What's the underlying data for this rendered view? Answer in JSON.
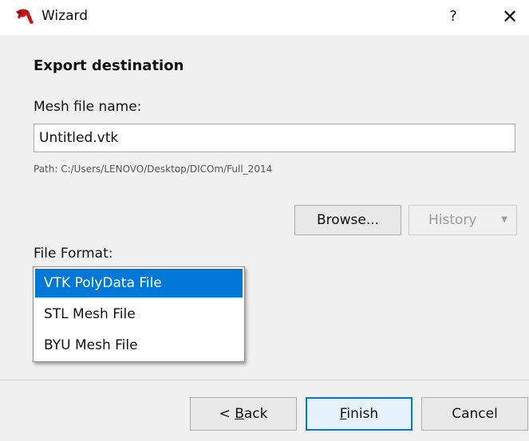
{
  "window": {
    "title": "Wizard",
    "help_glyph": "?",
    "close_glyph": "✕",
    "icon": "app-logo-icon"
  },
  "page": {
    "section_title": "Export destination",
    "mesh_label": "Mesh file name:",
    "mesh_value": "Untitled.vtk",
    "path_text": "Path: C:/Users/LENOVO/Desktop/DICOm/Full_2014",
    "browse_label": "Browse...",
    "history_label": "History",
    "history_arrow": "▼",
    "format_label": "File Format:",
    "formats": [
      {
        "label": "VTK PolyData File",
        "selected": true
      },
      {
        "label": "STL Mesh File",
        "selected": false
      },
      {
        "label": "BYU Mesh File",
        "selected": false
      }
    ]
  },
  "footer": {
    "back_prefix": "< ",
    "back_mnemonic": "B",
    "back_rest": "ack",
    "finish_mnemonic": "F",
    "finish_rest": "inish",
    "cancel_label": "Cancel"
  },
  "colors": {
    "accent": "#0078d7",
    "background": "#f0f0f0"
  }
}
